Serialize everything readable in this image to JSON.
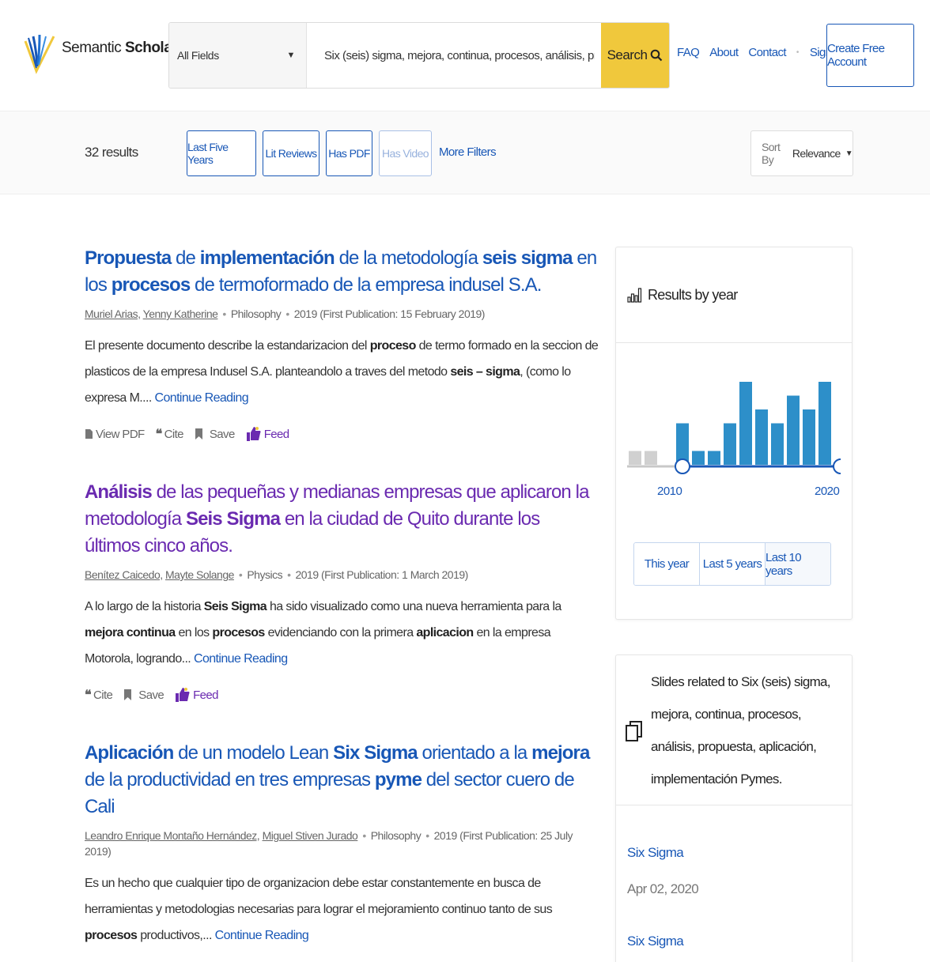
{
  "header": {
    "logo_plain": "Semantic ",
    "logo_bold": "Scholar",
    "field_select": "All Fields",
    "search_value": "Six (seis) sigma, mejora, continua, procesos, análisis, propuest...",
    "search_button": "Search",
    "nav": [
      "FAQ",
      "About",
      "Contact",
      "Sign In"
    ],
    "create_account": "Create Free Account"
  },
  "filters": {
    "results_count": "32 results",
    "chips": [
      "Last Five Years",
      "Lit Reviews",
      "Has PDF",
      "Has Video"
    ],
    "more_filters": "More Filters",
    "sort_label": "Sort By",
    "sort_value": "Relevance"
  },
  "papers": [
    {
      "meta_authors": [
        "Muriel Arias,",
        "Yenny Katherine"
      ],
      "field": "Philosophy",
      "date": "2019 (First Publication: 15 February 2019)",
      "continue": "Continue Reading",
      "actions": {
        "pdf": "View PDF",
        "cite": "Cite",
        "save": "Save",
        "feed": "Feed"
      }
    },
    {
      "meta_authors": [
        "Benítez Caicedo,",
        "Mayte Solange"
      ],
      "field": "Physics",
      "date": "2019 (First Publication: 1 March 2019)",
      "continue": "Continue Reading",
      "actions": {
        "cite": "Cite",
        "save": "Save",
        "feed": "Feed"
      }
    },
    {
      "meta_authors": [
        "Leandro Enrique Montaño Hernández,",
        "Miguel Stiven Jurado"
      ],
      "field": "Philosophy",
      "date": "2019 (First Publication: 25 July 2019)",
      "continue": "Continue Reading"
    }
  ],
  "sidebar": {
    "results_by_year": {
      "title": "Results by year",
      "start_label": "2010",
      "end_label": "2020",
      "bars": [
        {
          "year": 2007,
          "count": 1,
          "active": false
        },
        {
          "year": 2008,
          "count": 1,
          "active": false
        },
        {
          "year": 2009,
          "count": 0,
          "active": false
        },
        {
          "year": 2010,
          "count": 3,
          "active": true
        },
        {
          "year": 2011,
          "count": 1,
          "active": true
        },
        {
          "year": 2012,
          "count": 1,
          "active": true
        },
        {
          "year": 2013,
          "count": 3,
          "active": true
        },
        {
          "year": 2014,
          "count": 6,
          "active": true
        },
        {
          "year": 2015,
          "count": 4,
          "active": true
        },
        {
          "year": 2016,
          "count": 3,
          "active": true
        },
        {
          "year": 2017,
          "count": 5,
          "active": true
        },
        {
          "year": 2018,
          "count": 4,
          "active": true
        },
        {
          "year": 2019,
          "count": 6,
          "active": true
        },
        {
          "year": 2020,
          "count": 0,
          "active": true
        }
      ],
      "ranges": [
        "This year",
        "Last 5 years",
        "Last 10 years"
      ]
    },
    "slides": {
      "heading": "Slides related to Six (seis) sigma, mejora, continua, procesos, análisis, propuesta, aplicación, implementación Pymes.",
      "items": [
        {
          "title": "Six Sigma",
          "date": "Apr 02, 2020"
        },
        {
          "title": "Six Sigma",
          "date": ""
        }
      ]
    }
  },
  "colors": {
    "link": "#1857b6",
    "visited": "#6a2ab0",
    "search_button": "#f0c83c",
    "bar_active": "#2d8fc9",
    "bar_inactive": "#d0d0d0"
  }
}
